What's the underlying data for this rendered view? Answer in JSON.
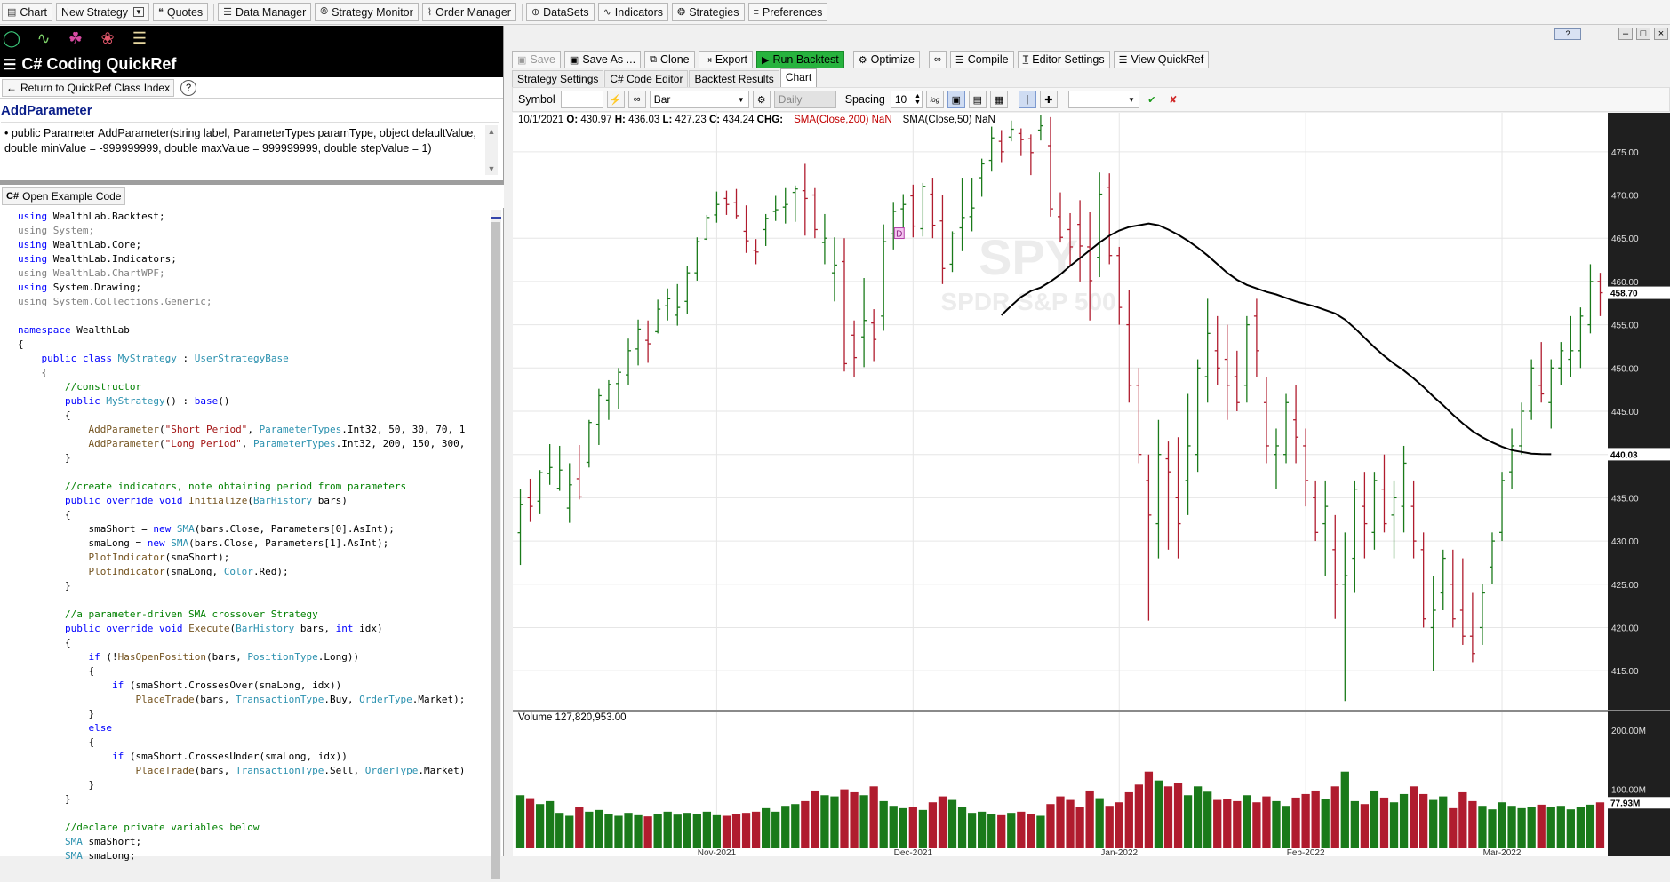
{
  "topbar": {
    "items": [
      {
        "icon": "chart-icon",
        "label": "Chart"
      },
      {
        "icon": "",
        "label": "New Strategy"
      },
      {
        "icon": "quotes-icon",
        "label": "Quotes"
      },
      {
        "icon": "data-manager-icon",
        "label": "Data Manager"
      },
      {
        "icon": "strategy-monitor-icon",
        "label": "Strategy Monitor"
      },
      {
        "icon": "order-manager-icon",
        "label": "Order Manager"
      },
      {
        "icon": "datasets-icon",
        "label": "DataSets"
      },
      {
        "icon": "indicators-icon",
        "label": "Indicators"
      },
      {
        "icon": "strategies-icon",
        "label": "Strategies"
      },
      {
        "icon": "preferences-icon",
        "label": "Preferences"
      }
    ]
  },
  "quickref": {
    "title": "C# Coding QuickRef",
    "return_label": "Return to QuickRef Class Index",
    "help": "?",
    "method_name": "AddParameter",
    "signature": "• public Parameter AddParameter(string label, ParameterTypes paramType, object defaultValue, double minValue = -999999999, double maxValue = 999999999, double stepValue = 1)",
    "example_button": "Open Example Code"
  },
  "code_lines": [
    "using WealthLab.Backtest;",
    "using System;",
    "using WealthLab.Core;",
    "using WealthLab.Indicators;",
    "using WealthLab.ChartWPF;",
    "using System.Drawing;",
    "using System.Collections.Generic;",
    "",
    "namespace WealthLab",
    "{",
    "    public class MyStrategy : UserStrategyBase",
    "    {",
    "        //constructor",
    "        public MyStrategy() : base()",
    "        {",
    "            AddParameter(\"Short Period\", ParameterTypes.Int32, 50, 30, 70, 1",
    "            AddParameter(\"Long Period\", ParameterTypes.Int32, 200, 150, 300,",
    "        }",
    "",
    "        //create indicators, note obtaining period from parameters",
    "        public override void Initialize(BarHistory bars)",
    "        {",
    "            smaShort = new SMA(bars.Close, Parameters[0].AsInt);",
    "            smaLong = new SMA(bars.Close, Parameters[1].AsInt);",
    "            PlotIndicator(smaShort);",
    "            PlotIndicator(smaLong, Color.Red);",
    "        }",
    "",
    "        //a parameter-driven SMA crossover Strategy",
    "        public override void Execute(BarHistory bars, int idx)",
    "        {",
    "            if (!HasOpenPosition(bars, PositionType.Long))",
    "            {",
    "                if (smaShort.CrossesOver(smaLong, idx))",
    "                    PlaceTrade(bars, TransactionType.Buy, OrderType.Market);",
    "            }",
    "            else",
    "            {",
    "                if (smaShort.CrossesUnder(smaLong, idx))",
    "                    PlaceTrade(bars, TransactionType.Sell, OrderType.Market)",
    "            }",
    "        }",
    "",
    "        //declare private variables below",
    "        SMA smaShort;",
    "        SMA smaLong;"
  ],
  "editor": {
    "hint": "?",
    "actions": [
      {
        "icon": "save-icon",
        "label": "Save",
        "disabled": true
      },
      {
        "icon": "save-as-icon",
        "label": "Save As ...",
        "disabled": false
      },
      {
        "icon": "clone-icon",
        "label": "Clone",
        "disabled": false
      },
      {
        "icon": "export-icon",
        "label": "Export",
        "disabled": false
      },
      {
        "icon": "run-icon",
        "label": "Run Backtest",
        "disabled": false
      },
      {
        "icon": "optimize-icon",
        "label": "Optimize",
        "disabled": false
      },
      {
        "icon": "link-icon",
        "label": "",
        "disabled": false
      },
      {
        "icon": "compile-icon",
        "label": "Compile",
        "disabled": false
      },
      {
        "icon": "editor-settings-icon",
        "label": "Editor Settings",
        "disabled": false
      },
      {
        "icon": "quickref-icon",
        "label": "View QuickRef",
        "disabled": false
      }
    ],
    "tabs": [
      "Strategy Settings",
      "C# Code Editor",
      "Backtest Results",
      "Chart"
    ],
    "active_tab": "Chart"
  },
  "chart_toolbar": {
    "symbol_label": "Symbol",
    "symbol_value": "",
    "chart_style": "Bar",
    "scale": "Daily",
    "spacing_label": "Spacing",
    "spacing_value": "10",
    "log": "log"
  },
  "chart_info": {
    "date": "10/1/2021",
    "open_label": "O:",
    "open": "430.97",
    "high_label": "H:",
    "high": "436.03",
    "low_label": "L:",
    "low": "427.23",
    "close_label": "C:",
    "close": "434.24",
    "chg_label": "CHG:",
    "sma200": "SMA(Close,200) NaN",
    "sma50": "SMA(Close,50) NaN",
    "watermark_symbol": "SPY",
    "watermark_name": "SPDR S&P 500",
    "volume_label": "Volume 127,820,953.00",
    "marker": "D",
    "colors": {
      "up": "#1a7a1a",
      "down": "#b01c2e",
      "sma": "#000000",
      "axis_bg": "#1f1f1f"
    }
  },
  "chart_data": {
    "type": "bar",
    "title": "",
    "symbol": "SPY",
    "price_axis": {
      "ylim": [
        410.5,
        479.5
      ],
      "ticks": [
        415,
        420,
        425,
        430,
        435,
        440,
        445,
        450,
        455,
        460,
        465,
        470,
        475
      ]
    },
    "price_tick_labels": [
      "415.00",
      "420.00",
      "425.00",
      "430.00",
      "435.00",
      "440.00",
      "445.00",
      "450.00",
      "455.00",
      "460.00",
      "465.00",
      "470.00",
      "475.00"
    ],
    "last_price_label": "458.70",
    "sma_last_label": "440.03",
    "volume_axis": {
      "ticks_m": [
        100,
        200
      ],
      "tick_labels": [
        "100.00M",
        "200.00M"
      ],
      "last_label": "77.93M",
      "last_m": 77.93
    },
    "x_tick_labels": [
      "Nov-2021",
      "Dec-2021",
      "Jan-2022",
      "Feb-2022",
      "Mar-2022"
    ],
    "x_tick_bar_index": [
      20,
      40,
      61,
      80,
      100
    ],
    "bars": [
      [
        430.97,
        436.03,
        427.23,
        434.24
      ],
      [
        435.0,
        437.2,
        432.2,
        434.0
      ],
      [
        434.6,
        438.2,
        433.1,
        437.9
      ],
      [
        437.8,
        441.2,
        436.5,
        438.5
      ],
      [
        436.1,
        441.0,
        435.8,
        438.2
      ],
      [
        433.8,
        439.0,
        432.1,
        436.5
      ],
      [
        437.2,
        441.1,
        434.8,
        435.1
      ],
      [
        439.1,
        444.0,
        438.5,
        443.7
      ],
      [
        443.5,
        447.6,
        441.1,
        446.8
      ],
      [
        446.3,
        448.6,
        444.0,
        448.1
      ],
      [
        448.2,
        450.0,
        445.3,
        449.5
      ],
      [
        449.2,
        453.4,
        448.0,
        452.0
      ],
      [
        452.2,
        455.6,
        450.3,
        454.5
      ],
      [
        453.2,
        455.5,
        450.6,
        452.8
      ],
      [
        454.2,
        457.9,
        454.0,
        456.8
      ],
      [
        457.2,
        459.2,
        455.5,
        458.0
      ],
      [
        456.1,
        459.7,
        454.9,
        457.0
      ],
      [
        457.7,
        461.8,
        456.2,
        461.0
      ],
      [
        461.0,
        465.1,
        460.1,
        464.6
      ],
      [
        464.9,
        467.7,
        464.8,
        467.4
      ],
      [
        467.7,
        470.4,
        466.8,
        468.9
      ],
      [
        469.6,
        470.5,
        467.7,
        468.9
      ],
      [
        469.1,
        470.7,
        467.3,
        467.6
      ],
      [
        465.8,
        468.8,
        463.3,
        464.7
      ],
      [
        463.6,
        464.9,
        462.0,
        463.4
      ],
      [
        466.0,
        467.8,
        464.1,
        467.3
      ],
      [
        468.1,
        469.9,
        467.0,
        468.3
      ],
      [
        468.6,
        470.8,
        466.7,
        468.9
      ],
      [
        470.3,
        471.1,
        466.9,
        470.7
      ],
      [
        470.5,
        473.6,
        465.3,
        469.6
      ],
      [
        470.0,
        470.8,
        465.0,
        466.0
      ],
      [
        464.5,
        467.8,
        462.0,
        465.0
      ],
      [
        461.0,
        465.1,
        457.7,
        461.9
      ],
      [
        462.3,
        465.0,
        449.6,
        450.5
      ],
      [
        453.8,
        455.5,
        448.9,
        451.2
      ],
      [
        453.6,
        460.4,
        450.1,
        455.5
      ],
      [
        455.2,
        456.8,
        450.8,
        453.3
      ],
      [
        456.0,
        466.6,
        454.3,
        464.6
      ],
      [
        465.5,
        469.2,
        463.7,
        468.1
      ],
      [
        468.4,
        470.1,
        465.8,
        468.9
      ],
      [
        469.9,
        471.2,
        465.1,
        466.4
      ],
      [
        466.1,
        471.4,
        465.2,
        471.0
      ],
      [
        470.1,
        472.0,
        465.0,
        466.5
      ],
      [
        467.0,
        470.0,
        459.7,
        461.5
      ],
      [
        462.0,
        465.8,
        461.1,
        465.5
      ],
      [
        466.2,
        472.0,
        463.5,
        467.4
      ],
      [
        467.5,
        472.0,
        465.8,
        468.5
      ],
      [
        472.0,
        474.2,
        469.8,
        473.6
      ],
      [
        474.0,
        477.9,
        472.7,
        476.6
      ],
      [
        476.2,
        477.5,
        473.8,
        475.0
      ],
      [
        476.7,
        478.6,
        476.2,
        477.6
      ],
      [
        477.1,
        477.7,
        474.5,
        476.4
      ],
      [
        476.5,
        477.0,
        472.3,
        474.9
      ],
      [
        477.5,
        479.2,
        476.3,
        478.0
      ],
      [
        475.7,
        479.0,
        467.5,
        468.4
      ],
      [
        467.5,
        470.3,
        464.5,
        465.1
      ],
      [
        466.0,
        467.9,
        461.7,
        464.0
      ],
      [
        466.6,
        469.4,
        460.0,
        464.1
      ],
      [
        464.0,
        468.0,
        455.5,
        460.1
      ],
      [
        462.8,
        472.6,
        460.5,
        470.1
      ],
      [
        470.9,
        472.5,
        462.0,
        463.0
      ],
      [
        463.0,
        464.0,
        455.0,
        457.0
      ],
      [
        455.0,
        459.0,
        446.0,
        448.0
      ],
      [
        448.0,
        450.0,
        439.0,
        440.0
      ],
      [
        437.0,
        440.0,
        420.8,
        433.0
      ],
      [
        432.0,
        444.0,
        428.0,
        440.0
      ],
      [
        439.5,
        441.5,
        429.0,
        438.0
      ],
      [
        435.0,
        442.0,
        428.0,
        432.0
      ],
      [
        437.0,
        447.0,
        433.0,
        441.0
      ],
      [
        440.0,
        451.0,
        438.0,
        450.0
      ],
      [
        449.0,
        458.0,
        446.0,
        454.0
      ],
      [
        452.0,
        456.0,
        448.0,
        450.0
      ],
      [
        451.0,
        455.0,
        444.0,
        448.0
      ],
      [
        449.0,
        452.0,
        445.0,
        446.0
      ],
      [
        448.0,
        456.0,
        446.0,
        455.0
      ],
      [
        456.0,
        458.0,
        449.0,
        452.0
      ],
      [
        446.0,
        449.0,
        439.0,
        441.0
      ],
      [
        440.0,
        443.0,
        436.0,
        441.0
      ],
      [
        440.0,
        447.0,
        439.0,
        446.0
      ],
      [
        444.0,
        448.0,
        439.0,
        442.0
      ],
      [
        441.0,
        443.0,
        434.0,
        437.0
      ],
      [
        435.0,
        437.0,
        430.0,
        431.0
      ],
      [
        432.0,
        437.0,
        426.0,
        434.0
      ],
      [
        429.0,
        433.0,
        421.0,
        425.0
      ],
      [
        425.0,
        431.0,
        411.5,
        426.0
      ],
      [
        428.0,
        437.0,
        424.0,
        436.0
      ],
      [
        434.0,
        438.0,
        428.0,
        432.0
      ],
      [
        431.0,
        438.0,
        429.0,
        437.0
      ],
      [
        436.0,
        440.0,
        431.0,
        432.0
      ],
      [
        433.0,
        437.0,
        428.0,
        435.0
      ],
      [
        434.0,
        441.0,
        431.0,
        439.0
      ],
      [
        434.0,
        437.0,
        428.0,
        430.0
      ],
      [
        429.0,
        431.0,
        420.0,
        421.0
      ],
      [
        420.0,
        426.0,
        415.0,
        422.0
      ],
      [
        424.0,
        429.0,
        422.0,
        428.0
      ],
      [
        425.0,
        429.0,
        420.0,
        421.0
      ],
      [
        422.0,
        428.0,
        418.0,
        419.0
      ],
      [
        419.0,
        424.0,
        416.0,
        417.0
      ],
      [
        420.0,
        425.0,
        418.0,
        424.0
      ],
      [
        427.0,
        431.0,
        425.0,
        430.0
      ],
      [
        431.0,
        438.0,
        430.0,
        437.0
      ],
      [
        438.0,
        443.0,
        436.0,
        441.0
      ],
      [
        441.0,
        446.0,
        440.0,
        445.0
      ],
      [
        445.0,
        451.0,
        444.0,
        450.0
      ],
      [
        448.0,
        453.0,
        446.0,
        447.0
      ],
      [
        446.0,
        451.0,
        443.0,
        450.0
      ],
      [
        450.0,
        453.0,
        448.0,
        452.0
      ],
      [
        451.0,
        456.0,
        449.0,
        452.0
      ],
      [
        452.0,
        457.0,
        450.0,
        456.0
      ],
      [
        455.0,
        462.0,
        454.0,
        460.0
      ],
      [
        460.0,
        461.0,
        456.0,
        458.7
      ]
    ],
    "sma50": [
      null,
      null,
      null,
      null,
      null,
      null,
      null,
      null,
      null,
      null,
      null,
      null,
      null,
      null,
      null,
      null,
      null,
      null,
      null,
      null,
      null,
      null,
      null,
      null,
      null,
      null,
      null,
      null,
      null,
      null,
      null,
      null,
      null,
      null,
      null,
      null,
      null,
      null,
      null,
      null,
      null,
      null,
      null,
      null,
      null,
      null,
      null,
      null,
      null,
      456.1,
      457.2,
      458.2,
      458.9,
      459.3,
      460.0,
      460.8,
      461.8,
      462.7,
      463.6,
      464.5,
      465.3,
      465.9,
      466.3,
      466.5,
      466.7,
      466.5,
      466.0,
      465.4,
      464.7,
      463.9,
      463.0,
      462.0,
      461.0,
      460.2,
      459.6,
      459.2,
      458.8,
      458.5,
      458.1,
      457.7,
      457.4,
      457.1,
      456.7,
      456.3,
      455.6,
      454.6,
      453.5,
      452.4,
      451.4,
      450.5,
      449.7,
      448.8,
      447.8,
      446.7,
      445.7,
      444.6,
      443.6,
      442.7,
      442.0,
      441.4,
      440.9,
      440.5,
      440.3,
      440.1,
      440.05,
      440.03
    ],
    "volume_m": [
      90,
      85,
      75,
      80,
      60,
      55,
      70,
      62,
      65,
      58,
      55,
      60,
      56,
      54,
      58,
      62,
      57,
      60,
      58,
      62,
      56,
      55,
      58,
      60,
      62,
      68,
      62,
      72,
      75,
      80,
      98,
      90,
      88,
      100,
      95,
      90,
      105,
      80,
      72,
      68,
      70,
      65,
      78,
      88,
      82,
      70,
      60,
      62,
      58,
      56,
      60,
      62,
      58,
      55,
      75,
      88,
      82,
      70,
      98,
      85,
      72,
      78,
      95,
      108,
      130,
      115,
      105,
      110,
      90,
      105,
      96,
      82,
      84,
      80,
      90,
      78,
      88,
      80,
      72,
      86,
      92,
      98,
      84,
      105,
      130,
      80,
      75,
      98,
      86,
      78,
      92,
      105,
      92,
      82,
      88,
      68,
      95,
      80,
      72,
      66,
      78,
      72,
      68,
      70,
      74,
      70,
      72,
      66,
      70,
      74,
      77.93
    ]
  }
}
